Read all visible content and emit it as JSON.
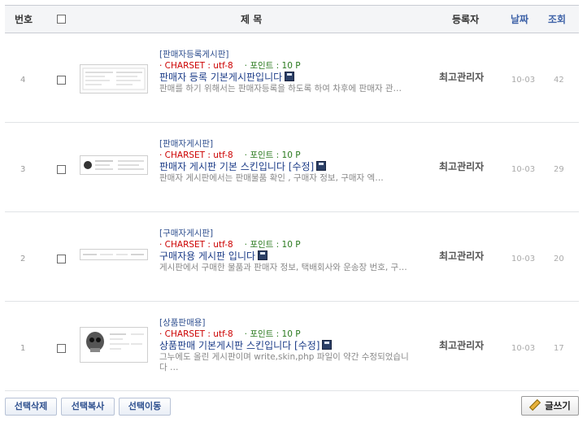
{
  "header": {
    "num": "번호",
    "title": "제  목",
    "author": "등록자",
    "date": "날짜",
    "hits": "조회"
  },
  "posts": [
    {
      "num": "4",
      "category": "[판매자등록게시판]",
      "charset": "· CHARSET : utf-8",
      "point": "· 포인트 : 10 P",
      "title": "판매자 등록 기본게시판입니다",
      "edit": "",
      "desc": "  판매를 하기 위해서는 판매자등록을 하도록 하여 차후에 판매자 관…",
      "author": "최고관리자",
      "date": "10-03",
      "hits": "42",
      "thumb": "table"
    },
    {
      "num": "3",
      "category": "[판매자게시판]",
      "charset": "· CHARSET : utf-8",
      "point": "· 포인트 : 10 P",
      "title": "판매자 게시판 기본 스킨입니다",
      "edit": "[수정]",
      "desc": "  판매자 게시판에서는 판매물품 확인 , 구매자 정보, 구매자 엑…",
      "author": "최고관리자",
      "date": "10-03",
      "hits": "29",
      "thumb": "list"
    },
    {
      "num": "2",
      "category": "[구매자게시판]",
      "charset": "· CHARSET : utf-8",
      "point": "· 포인트 : 10 P",
      "title": "구매자용 게시판 입니다",
      "edit": "",
      "desc": "  게시판에서 구매한 물품과 판매자 정보, 택배회사와 운송장 번호, 구…",
      "author": "최고관리자",
      "date": "10-03",
      "hits": "20",
      "thumb": "thin"
    },
    {
      "num": "1",
      "category": "[상품판매용]",
      "charset": "· CHARSET : utf-8",
      "point": "· 포인트 : 10 P",
      "title": "상품판매 기본게시판 스킨입니다",
      "edit": "[수정]",
      "desc": "그누에도 올린 게시판이며 write,skin,php 파일이 약간 수정되었습니다    …",
      "author": "최고관리자",
      "date": "10-03",
      "hits": "17",
      "thumb": "skull"
    }
  ],
  "actions": {
    "delete_selected": "선택삭제",
    "copy_selected": "선택복사",
    "move_selected": "선택이동",
    "write": "글쓰기",
    "write_icon": "pencil-icon"
  },
  "colors": {
    "link_blue": "#1d3d88",
    "charset_red": "#cc0000",
    "point_green": "#2a7a1e",
    "header_bg": "#f4f5f7"
  }
}
